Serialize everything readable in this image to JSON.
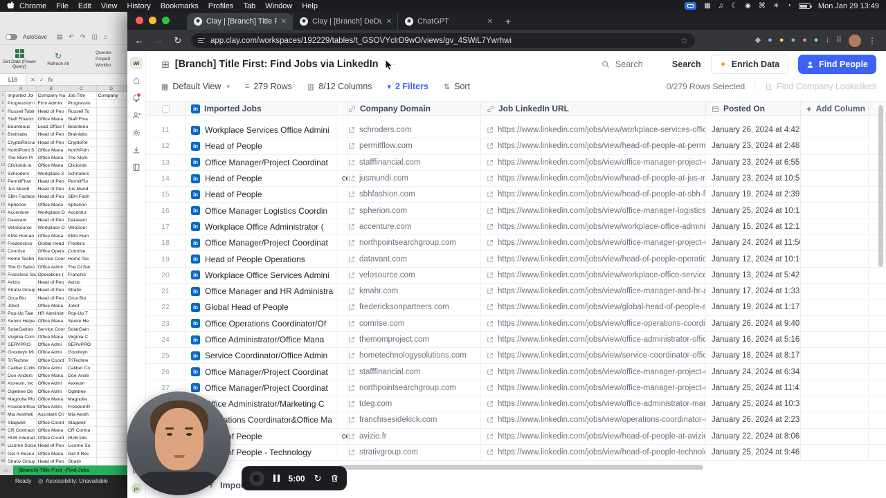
{
  "menubar": {
    "items": [
      "Chrome",
      "File",
      "Edit",
      "View",
      "History",
      "Bookmarks",
      "Profiles",
      "Tab",
      "Window",
      "Help"
    ],
    "status_icons": [
      {
        "name": "grid-icon",
        "glyph": "▦"
      },
      {
        "name": "music-icon",
        "glyph": "♫"
      },
      {
        "name": "moon-icon",
        "glyph": "☾"
      },
      {
        "name": "camera-icon",
        "glyph": "◉"
      },
      {
        "name": "command-icon",
        "glyph": "⌘"
      },
      {
        "name": "brightness-icon",
        "glyph": "☀"
      },
      {
        "name": "clock-icon",
        "glyph": "◔"
      }
    ],
    "clock": "Mon Jan 29 13:49"
  },
  "excel": {
    "autosave_label": "AutoSave",
    "quick_icons": [
      "▤",
      "↶",
      "↷",
      "◫",
      "⌂"
    ],
    "ribbon": {
      "get_data": "Get Data (Power Query)",
      "refresh_all": "Refresh All",
      "panel": [
        "Queries",
        "Propert",
        "Workbo"
      ]
    },
    "name_box": "L16",
    "cancel_glyph": "✕",
    "enter_glyph": "✓",
    "fx_label": "fx",
    "column_headers": [
      "A",
      "B",
      "C",
      "D"
    ],
    "rows": [
      [
        "Imported Jol",
        "Company Na",
        "Job Title",
        "Company"
      ],
      [
        "Progression I",
        "Firm Admini",
        "Progressio",
        ""
      ],
      [
        "Russell Tobir",
        "Head of Peo",
        "Russell To",
        ""
      ],
      [
        "Staff Financi",
        "Office Mana",
        "Staff Fina",
        ""
      ],
      [
        "Bounteous",
        "Lead Office f",
        "Bounteou",
        ""
      ],
      [
        "Brainlabs",
        "Head of Peo",
        "Brainlabs",
        ""
      ],
      [
        "CryptoRecrui",
        "Head of Peo",
        "CryptoRe",
        ""
      ],
      [
        "NorthPoint S",
        "Office Mana",
        "NorthPoin",
        ""
      ],
      [
        "The Mom Pr",
        "Office Mana",
        "The Mom",
        ""
      ],
      [
        "Clickslob.io",
        "Office Mana",
        "Clickslob",
        ""
      ],
      [
        "Schroders",
        "Workplace S",
        "Schroders",
        ""
      ],
      [
        "PermitFlow",
        "Head of Peo",
        "PermitFlo",
        ""
      ],
      [
        "Jus Mundi",
        "Head of Peo",
        "Jus Mund",
        ""
      ],
      [
        "SBH Fashion",
        "Head of Peo",
        "SBH Fash",
        ""
      ],
      [
        "Spherion",
        "Office Mana",
        "Spherion",
        ""
      ],
      [
        "Accenture",
        "Workplace O",
        "Accentur",
        ""
      ],
      [
        "Datavant",
        "Head of Peo",
        "Datavant",
        ""
      ],
      [
        "VeloSource",
        "Workplace O",
        "VeloSour",
        ""
      ],
      [
        "KMA Human",
        "Office Mana",
        "KMA Hum",
        ""
      ],
      [
        "Frederickso",
        "Global Head",
        "Frederic",
        ""
      ],
      [
        "Comrise",
        "Office Opera",
        "Comrise",
        ""
      ],
      [
        "Home Techn",
        "Service Coor",
        "Home Tec",
        ""
      ],
      [
        "The Di Salvo",
        "Office Admir",
        "The Di Sal",
        ""
      ],
      [
        "Franchise Sic",
        "Operations (",
        "Franchis",
        ""
      ],
      [
        "Avizio",
        "Head of Peo",
        "Avizio",
        ""
      ],
      [
        "Strativ Group",
        "Head of Peo",
        "Strativ",
        ""
      ],
      [
        "Orca Bio",
        "Head of Peo",
        "Orca Bio",
        ""
      ],
      [
        "Jobot",
        "Office Mana",
        "Jobot",
        ""
      ],
      [
        "Pop-Up Tale",
        "HR Administ",
        "Pop-Up T",
        ""
      ],
      [
        "Senior Helpe",
        "Office Mana",
        "Senior He",
        ""
      ],
      [
        "SolarGaines",
        "Service Coor",
        "SolarGain",
        ""
      ],
      [
        "Virginia Com",
        "Office Mana",
        "Virginia C",
        ""
      ],
      [
        "SERVPRO",
        "Office Admi",
        "SERVPRO",
        ""
      ],
      [
        "Goodwyn Mi",
        "Office Admi",
        "Goodwyn",
        ""
      ],
      [
        "TriTechne",
        "Office Coord",
        "TriTechne",
        ""
      ],
      [
        "Caliber Collis",
        "Office Admi",
        "Caliber Co",
        ""
      ],
      [
        "Doe-Anders",
        "Office Mana",
        "Doe-Ande",
        ""
      ],
      [
        "Axxeum, Inc",
        "Office Admi",
        "Axxeum",
        ""
      ],
      [
        "Ogletree De",
        "Office Admi",
        "Ogletree",
        ""
      ],
      [
        "Magnolia Plu",
        "Office Mana",
        "Magnolia",
        ""
      ],
      [
        "FreedomRoa",
        "Office Admi",
        "FreedomR",
        ""
      ],
      [
        "Mia Aestheti",
        "Assistant Cli",
        "Mia Aesth",
        ""
      ],
      [
        "Stagwell",
        "Office Coord",
        "Stagwell",
        ""
      ],
      [
        "CR Contracti",
        "Office Mana",
        "CR Contra",
        ""
      ],
      [
        "HUB Internat",
        "Office Coord",
        "HUB Inte",
        ""
      ],
      [
        "Licorne Socie",
        "Head of Peo",
        "Licorne So",
        ""
      ],
      [
        "Get It Recrui",
        "Office Mana",
        "Get It Rec",
        ""
      ],
      [
        "Strativ Group",
        "Head of Peo",
        "Strativ",
        ""
      ]
    ],
    "sheet_tab": "(Branch)-Title-First_-Find-Jobs",
    "status_ready": "Ready",
    "status_accessibility": "Accessibility: Unavailable"
  },
  "browser": {
    "tabs": [
      {
        "label": "Clay | [Branch] Title First",
        "close": "✕"
      },
      {
        "label": "Clay | [Branch] DeDupe-Title",
        "close": "✕"
      },
      {
        "label": "ChatGPT",
        "close": "✕"
      }
    ],
    "new_tab": "+",
    "back": "←",
    "forward": "→",
    "reload": "↻",
    "star": "☆",
    "url": "app.clay.com/workspaces/192229/tables/t_GSOVYclrD9wO/views/gv_4SWiL7Ywrhwi",
    "extensions": [
      {
        "name": "extension-gray",
        "glyph": "◆",
        "color": "#aeb3ba"
      },
      {
        "name": "extension-blue",
        "glyph": "●",
        "color": "#8ab4f8"
      },
      {
        "name": "extension-yellow",
        "glyph": "●",
        "color": "#fdd663"
      },
      {
        "name": "extension-green",
        "glyph": "●",
        "color": "#81c995"
      },
      {
        "name": "extension-red",
        "glyph": "●",
        "color": "#f28b82"
      },
      {
        "name": "extension-teal",
        "glyph": "●",
        "color": "#78d9ec"
      },
      {
        "name": "downloads-icon",
        "glyph": "↓",
        "color": "#c7cbd1"
      },
      {
        "name": "apps-grid-icon",
        "glyph": "⠿",
        "color": "#c7cbd1"
      }
    ]
  },
  "clay": {
    "workspace_badge": "wi",
    "user_badge": "jo",
    "title": "[Branch] Title First: Find Jobs via LinkedIn",
    "title_menu": "⋯",
    "search_placeholder": "Search",
    "search_button": "Search",
    "enrich_button": "Enrich Data",
    "find_people_button": "Find People",
    "toolbar": {
      "view": "Default View",
      "rows_count": "279 Rows",
      "columns_count": "8/12 Columns",
      "filters_count": "2 Filters",
      "sort": "Sort",
      "rows_selected": "0/279 Rows Selected",
      "lookalikes": "Find Company Lookalikes"
    },
    "table": {
      "col_imported_jobs": "Imported Jobs",
      "col_company_domain": "Company Domain",
      "col_job_linkedin_url": "Job LinkedIn URL",
      "col_posted_on": "Posted On",
      "add_column": "Add Column",
      "linkedin_badge": "in"
    },
    "rows": [
      {
        "num": "11",
        "job": "Workplace Services Office Admini",
        "clip": "",
        "domain": "schroders.com",
        "url": "https://www.linkedin.com/jobs/view/workplace-services-office-ad...",
        "posted": "January 26, 2024 at 4:42 ..."
      },
      {
        "num": "12",
        "job": "Head of People",
        "clip": "",
        "domain": "permitflow.com",
        "url": "https://www.linkedin.com/jobs/view/head-of-people-at-permitflow-...",
        "posted": "January 23, 2024 at 2:48 ..."
      },
      {
        "num": "13",
        "job": "Office Manager/Project Coordinat",
        "clip": "",
        "domain": "stafffinancial.com",
        "url": "https://www.linkedin.com/jobs/view/office-manager-project-coordi...",
        "posted": "January 23, 2024 at 6:55 ..."
      },
      {
        "num": "14",
        "job": "Head of People",
        "clip": "ce",
        "domain": "jusmundi.com",
        "url": "https://www.linkedin.com/jobs/view/head-of-people-at-jus-mundi-...",
        "posted": "January 23, 2024 at 10:51 ..."
      },
      {
        "num": "15",
        "job": "Head of People",
        "clip": "",
        "domain": "sbhfashion.com",
        "url": "https://www.linkedin.com/jobs/view/head-of-people-at-sbh-fashio...",
        "posted": "January 19, 2024 at 2:39 ..."
      },
      {
        "num": "16",
        "job": "Office Manager Logistics Coordin",
        "clip": "",
        "domain": "spherion.com",
        "url": "https://www.linkedin.com/jobs/view/office-manager-logistics-coor...",
        "posted": "January 25, 2024 at 10:18 ..."
      },
      {
        "num": "17",
        "job": "Workplace Office Administrator (",
        "clip": "",
        "domain": "accenture.com",
        "url": "https://www.linkedin.com/jobs/view/workplace-office-administrator...",
        "posted": "January 15, 2024 at 12:13 ..."
      },
      {
        "num": "18",
        "job": "Office Manager/Project Coordinat",
        "clip": "",
        "domain": "northpointsearchgroup.com",
        "url": "https://www.linkedin.com/jobs/view/office-manager-project-coordi...",
        "posted": "January 24, 2024 at 11:50 ..."
      },
      {
        "num": "19",
        "job": "Head of People Operations",
        "clip": "",
        "domain": "datavant.com",
        "url": "https://www.linkedin.com/jobs/view/head-of-people-operations-at-...",
        "posted": "January 12, 2024 at 10:10 ..."
      },
      {
        "num": "20",
        "job": "Workplace Office Services Admini",
        "clip": "",
        "domain": "velosource.com",
        "url": "https://www.linkedin.com/jobs/view/workplace-office-services-ad...",
        "posted": "January 13, 2024 at 5:42 ..."
      },
      {
        "num": "21",
        "job": "Office Manager and HR Administra",
        "clip": "",
        "domain": "kmahr.com",
        "url": "https://www.linkedin.com/jobs/view/office-manager-and-hr-admini...",
        "posted": "January 17, 2024 at 1:33 P..."
      },
      {
        "num": "22",
        "job": "Global Head of People",
        "clip": "",
        "domain": "fredericksonpartners.com",
        "url": "https://www.linkedin.com/jobs/view/global-head-of-people-at-fred...",
        "posted": "January 19, 2024 at 1:17 P..."
      },
      {
        "num": "23",
        "job": "Office Operations Coordinator/Of",
        "clip": "",
        "domain": "comrise.com",
        "url": "https://www.linkedin.com/jobs/view/office-operations-coordinator-...",
        "posted": "January 26, 2024 at 9:40 ..."
      },
      {
        "num": "24",
        "job": "Office Administrator/Office Mana",
        "clip": "",
        "domain": "themomproject.com",
        "url": "https://www.linkedin.com/jobs/view/office-administrator-office-ma...",
        "posted": "January 16, 2024 at 5:16 ..."
      },
      {
        "num": "25",
        "job": "Service Coordinator/Office Admin",
        "clip": "",
        "domain": "hometechnologysolutions.com",
        "url": "https://www.linkedin.com/jobs/view/service-coordinator-office-ad...",
        "posted": "January 18, 2024 at 8:17 ..."
      },
      {
        "num": "26",
        "job": "Office Manager/Project Coordinat",
        "clip": "",
        "domain": "stafffinancial.com",
        "url": "https://www.linkedin.com/jobs/view/office-manager-project-coordi...",
        "posted": "January 24, 2024 at 6:34 ..."
      },
      {
        "num": "27",
        "job": "Office Manager/Project Coordinat",
        "clip": "",
        "domain": "northpointsearchgroup.com",
        "url": "https://www.linkedin.com/jobs/view/office-manager-project-coordi...",
        "posted": "January 25, 2024 at 11:41 ..."
      },
      {
        "num": "28",
        "job": "Office Administrator/Marketing C",
        "clip": "",
        "domain": "tdeg.com",
        "url": "https://www.linkedin.com/jobs/view/office-administrator-marketing...",
        "posted": "January 25, 2024 at 10:35..."
      },
      {
        "num": "29",
        "job": "Operations Coordinator&Office Ma",
        "clip": "",
        "domain": "franchisesidekick.com",
        "url": "https://www.linkedin.com/jobs/view/operations-coordinator-office-...",
        "posted": "January 26, 2024 at 2:23 ..."
      },
      {
        "num": "30",
        "job": "Head of People",
        "clip": "ce",
        "domain": "avizio.fr",
        "url": "https://www.linkedin.com/jobs/view/head-of-people-at-avizio-wefy...",
        "posted": "January 22, 2024 at 8:06 ..."
      },
      {
        "num": "31",
        "job": "Head of People - Technology",
        "clip": "",
        "domain": "strativgroup.com",
        "url": "https://www.linkedin.com/jobs/view/head-of-people-technology-at-...",
        "posted": "January 25, 2024 at 9:46 ..."
      }
    ],
    "import_button": "Import..."
  },
  "recorder": {
    "time": "5:00"
  },
  "colors": {
    "accent_blue": "#3e63f4",
    "linkedin_blue": "#0a66c2",
    "sheet_tab_green": "#26b15c"
  }
}
